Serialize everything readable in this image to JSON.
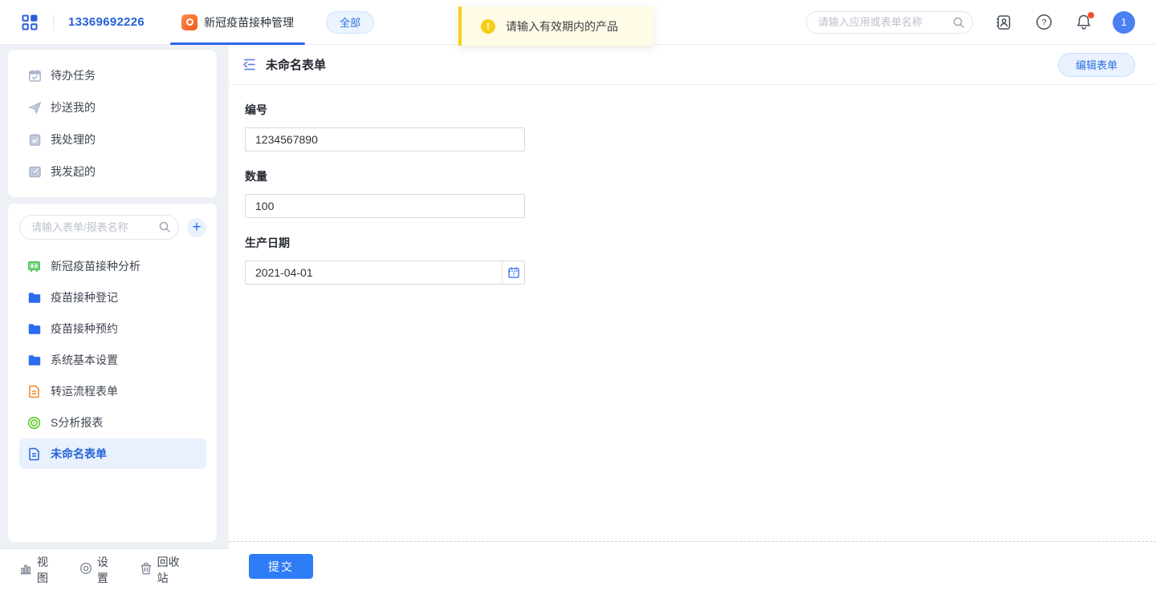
{
  "topbar": {
    "phone": "13369692226",
    "app_tab_label": "新冠疫苗接种管理",
    "filter_pill_label": "全部",
    "search_placeholder": "请输入应用或表单名称",
    "avatar_text": "1"
  },
  "toast": {
    "message": "请输入有效期内的产品"
  },
  "sidebar": {
    "tasks": [
      {
        "label": "待办任务",
        "icon": "calendar-check-icon"
      },
      {
        "label": "抄送我的",
        "icon": "send-icon"
      },
      {
        "label": "我处理的",
        "icon": "clipboard-check-icon"
      },
      {
        "label": "我发起的",
        "icon": "edit-doc-icon"
      }
    ],
    "search_placeholder": "请输入表单/报表名称",
    "add_button_label": "+",
    "nav": [
      {
        "label": "新冠疫苗接种分析",
        "icon": "dashboard-icon",
        "color": "#49bd4f",
        "selected": false
      },
      {
        "label": "疫苗接种登记",
        "icon": "folder-icon",
        "color": "#2b6cf0",
        "selected": false
      },
      {
        "label": "疫苗接种预约",
        "icon": "folder-icon",
        "color": "#2b6cf0",
        "selected": false
      },
      {
        "label": "系统基本设置",
        "icon": "folder-icon",
        "color": "#2b6cf0",
        "selected": false
      },
      {
        "label": "转运流程表单",
        "icon": "document-icon",
        "color": "#f58220",
        "selected": false
      },
      {
        "label": "S分析报表",
        "icon": "target-icon",
        "color": "#52c41a",
        "selected": false
      },
      {
        "label": "未命名表单",
        "icon": "document-icon",
        "color": "#2b6cf0",
        "selected": true
      }
    ],
    "footer": [
      {
        "label": "视图",
        "icon": "bar-chart-icon"
      },
      {
        "label": "设置",
        "icon": "settings-icon"
      },
      {
        "label": "回收站",
        "icon": "trash-icon"
      }
    ]
  },
  "main": {
    "title": "未命名表单",
    "edit_button_label": "编辑表单",
    "fields": [
      {
        "label": "编号",
        "value": "1234567890",
        "type": "text"
      },
      {
        "label": "数量",
        "value": "100",
        "type": "text"
      },
      {
        "label": "生产日期",
        "value": "2021-04-01",
        "type": "date"
      }
    ],
    "submit_button_label": "提交"
  },
  "colors": {
    "primary_blue": "#2b6cf0",
    "tab_underline": "#2d66e8",
    "selected_item_bg": "#e8f1fd",
    "toast_bg": "#fffbe6",
    "warning_yellow": "#f7ce16",
    "submit_blue": "#2e7cf6",
    "avatar_blue": "#4b80f2",
    "notification_red": "#f5502e",
    "sidebar_bg": "#edf0f5"
  }
}
